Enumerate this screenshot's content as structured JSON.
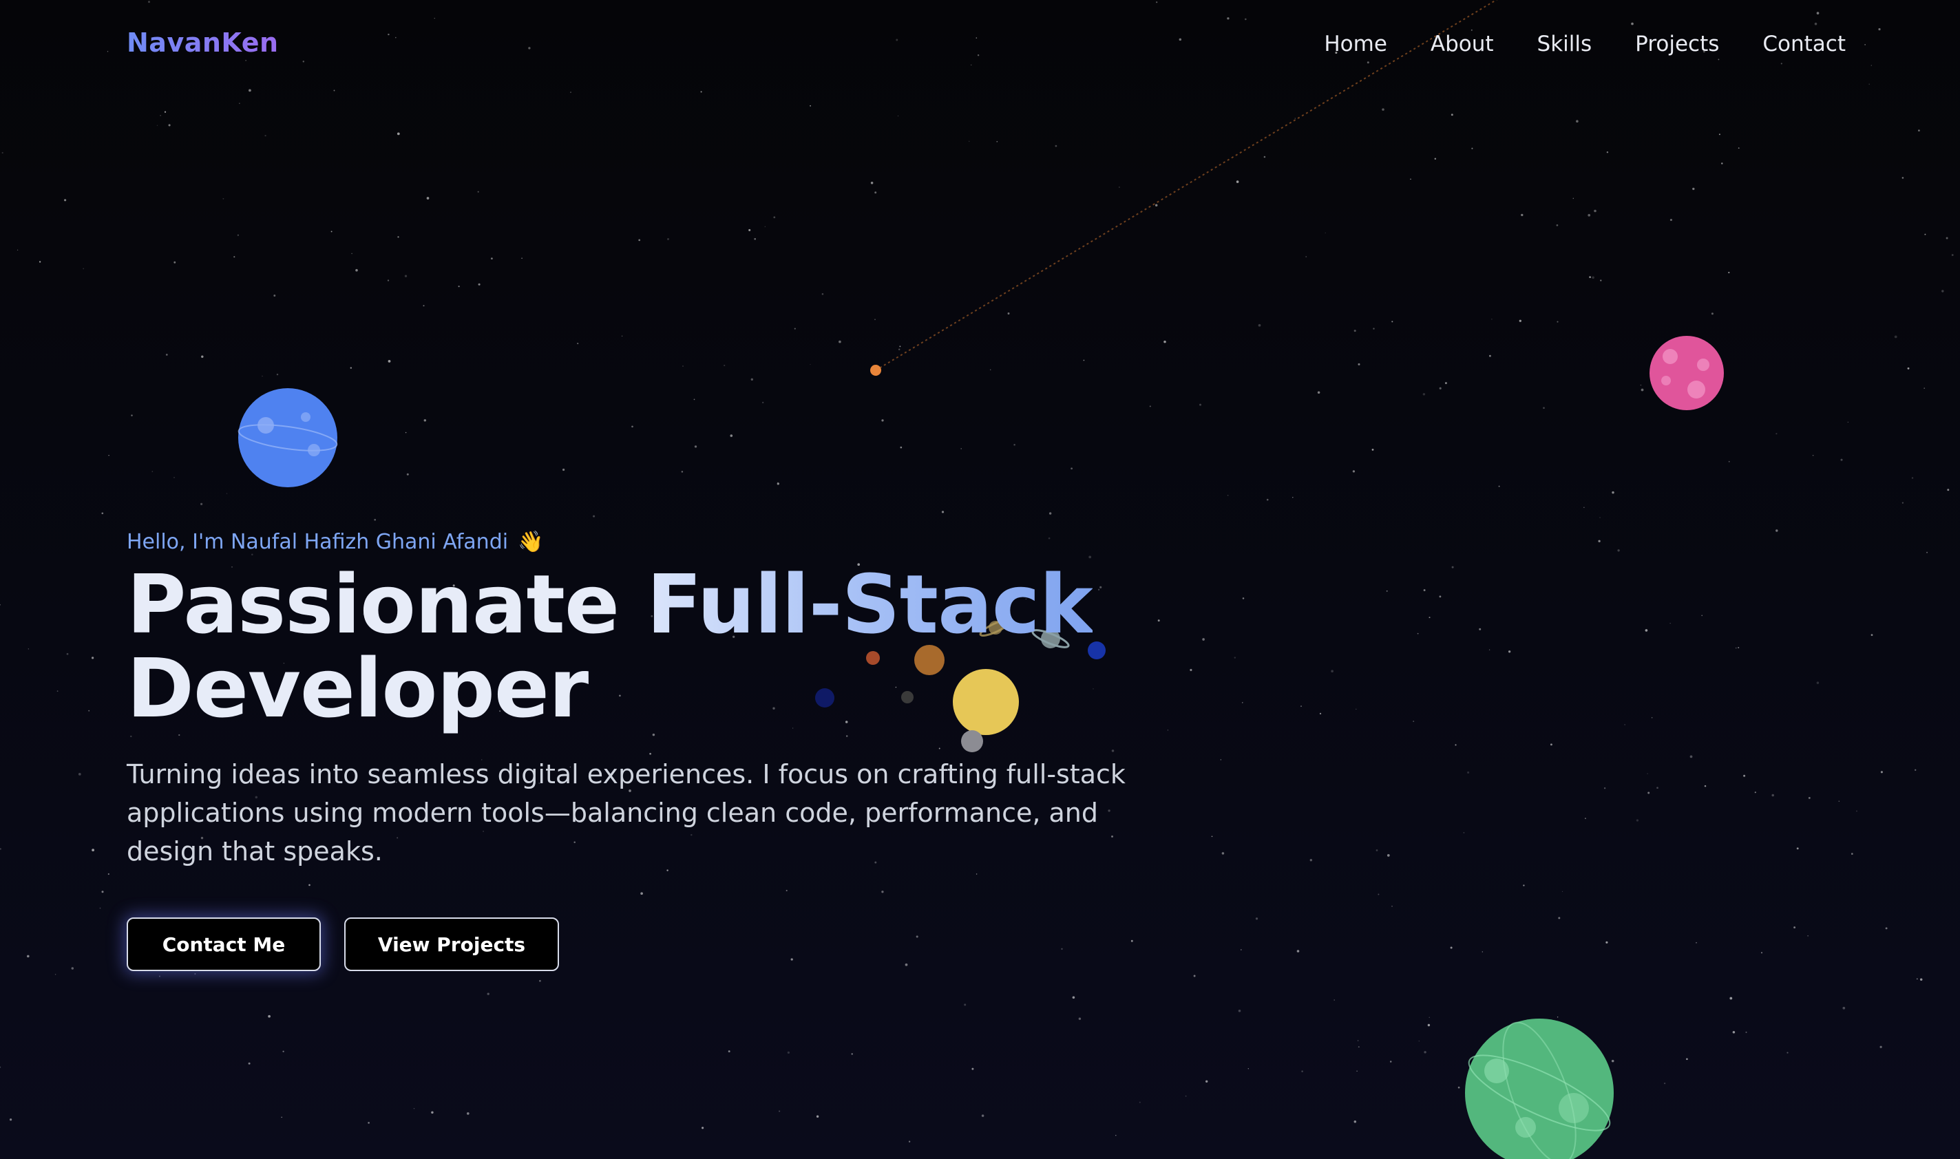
{
  "brand": {
    "name": "NavanKen",
    "accent": "#7d7df3"
  },
  "nav": {
    "items": [
      {
        "label": "Home"
      },
      {
        "label": "About"
      },
      {
        "label": "Skills"
      },
      {
        "label": "Projects"
      },
      {
        "label": "Contact"
      }
    ]
  },
  "hero": {
    "greeting": "Hello, I'm Naufal Hafizh Ghani Afandi",
    "wave_icon": "👋",
    "headline_part1": "Passionate ",
    "headline_part2": "Full-Stack",
    "headline_part3": "Developer",
    "description": "Turning ideas into seamless digital experiences. I focus on crafting full-stack applications using modern tools—balancing clean code, performance, and design that speaks.",
    "buttons": {
      "contact_label": "Contact Me",
      "projects_label": "View Projects"
    }
  },
  "decor": {
    "icons": [
      "star-field",
      "shooting-star-icon",
      "blue-planet-icon",
      "pink-planet-icon",
      "green-planet-icon",
      "solar-system-icon"
    ],
    "colors": {
      "blue_planet": "#4f82f0",
      "pink_planet": "#e0559b",
      "green_planet": "#53b77d",
      "sun": "#e6c757",
      "shooting_star": "#e8853a"
    }
  }
}
